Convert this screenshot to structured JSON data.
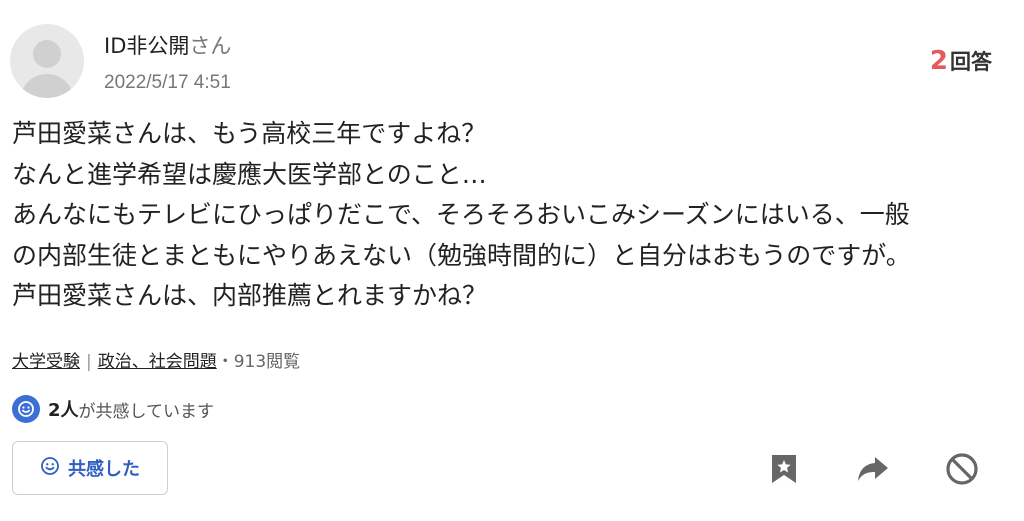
{
  "question": {
    "user_name": "ID非公開",
    "user_suffix": "さん",
    "date": "2022/5/17 4:51",
    "answer_count": "2",
    "answer_label": "回答",
    "body_lines": [
      "芦田愛菜さんは、もう高校三年ですよね？",
      "なんと進学希望は慶應大医学部とのこと…",
      "あんなにもテレビにひっぱりだこで、そろそろおいこみシーズンにはいる、一般",
      "の内部生徒とまともにやりあえない（勉強時間的に）と自分はおもうのですが。",
      "芦田愛菜さんは、内部推薦とれますかね？"
    ]
  },
  "meta": {
    "category1": "大学受験",
    "separator": "|",
    "category2": "政治、社会問題",
    "views": "・913閲覧"
  },
  "empathy": {
    "count": "2人",
    "text": "が共感しています",
    "button_label": "共感した"
  },
  "icons": {
    "avatar": "default-user-avatar",
    "smile": "smile-icon",
    "bookmark": "bookmark-star-icon",
    "share": "share-arrow-icon",
    "block": "prohibit-icon"
  },
  "colors": {
    "accent_blue": "#2f5fc4",
    "answer_number_red": "#e25a5a",
    "icon_gray": "#666666"
  }
}
